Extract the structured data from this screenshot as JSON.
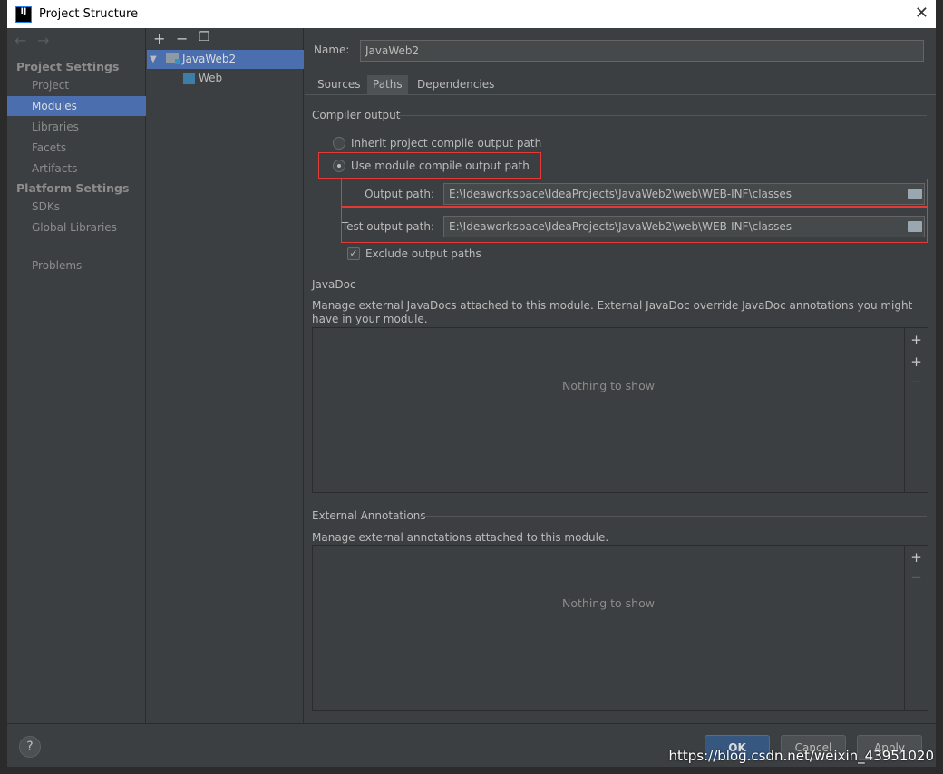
{
  "window": {
    "title": "Project Structure",
    "logo": "IJ"
  },
  "sidebar": {
    "project_settings_header": "Project Settings",
    "project_items": [
      "Project",
      "Modules",
      "Libraries",
      "Facets",
      "Artifacts"
    ],
    "platform_settings_header": "Platform Settings",
    "platform_items": [
      "SDKs",
      "Global Libraries"
    ],
    "problems": "Problems",
    "selected": "Modules"
  },
  "tree": {
    "items": [
      {
        "label": "JavaWeb2",
        "icon": "module-folder-icon"
      },
      {
        "label": "Web",
        "icon": "web-facet-icon"
      }
    ]
  },
  "main": {
    "name_label": "Name:",
    "name_value": "JavaWeb2",
    "tabs": [
      {
        "label": "Sources"
      },
      {
        "label": "Paths",
        "selected": true
      },
      {
        "label": "Dependencies"
      }
    ],
    "compiler_output": {
      "title": "Compiler output",
      "inherit_label": "Inherit project compile output path",
      "use_module_label": "Use module compile output path",
      "selected": "use_module",
      "output_path_label": "Output path:",
      "output_path": "E:\\Ideaworkspace\\IdeaProjects\\JavaWeb2\\web\\WEB-INF\\classes",
      "test_output_path_label": "Test output path:",
      "test_output_path": "E:\\Ideaworkspace\\IdeaProjects\\JavaWeb2\\web\\WEB-INF\\classes",
      "exclude_label": "Exclude output paths",
      "exclude_checked": true
    },
    "javadoc": {
      "title": "JavaDoc",
      "description": "Manage external JavaDocs attached to this module. External JavaDoc override JavaDoc annotations you might have in your module.",
      "empty": "Nothing to show"
    },
    "annotations": {
      "title": "External Annotations",
      "description": "Manage external annotations attached to this module.",
      "empty": "Nothing to show"
    }
  },
  "footer": {
    "ok": "OK",
    "cancel": "Cancel",
    "apply": "Apply",
    "help": "?"
  },
  "watermark": "https://blog.csdn.net/weixin_43951020",
  "colors": {
    "accent": "#4b6eaf",
    "highlight": "#e53935",
    "background": "#3c3f41"
  }
}
